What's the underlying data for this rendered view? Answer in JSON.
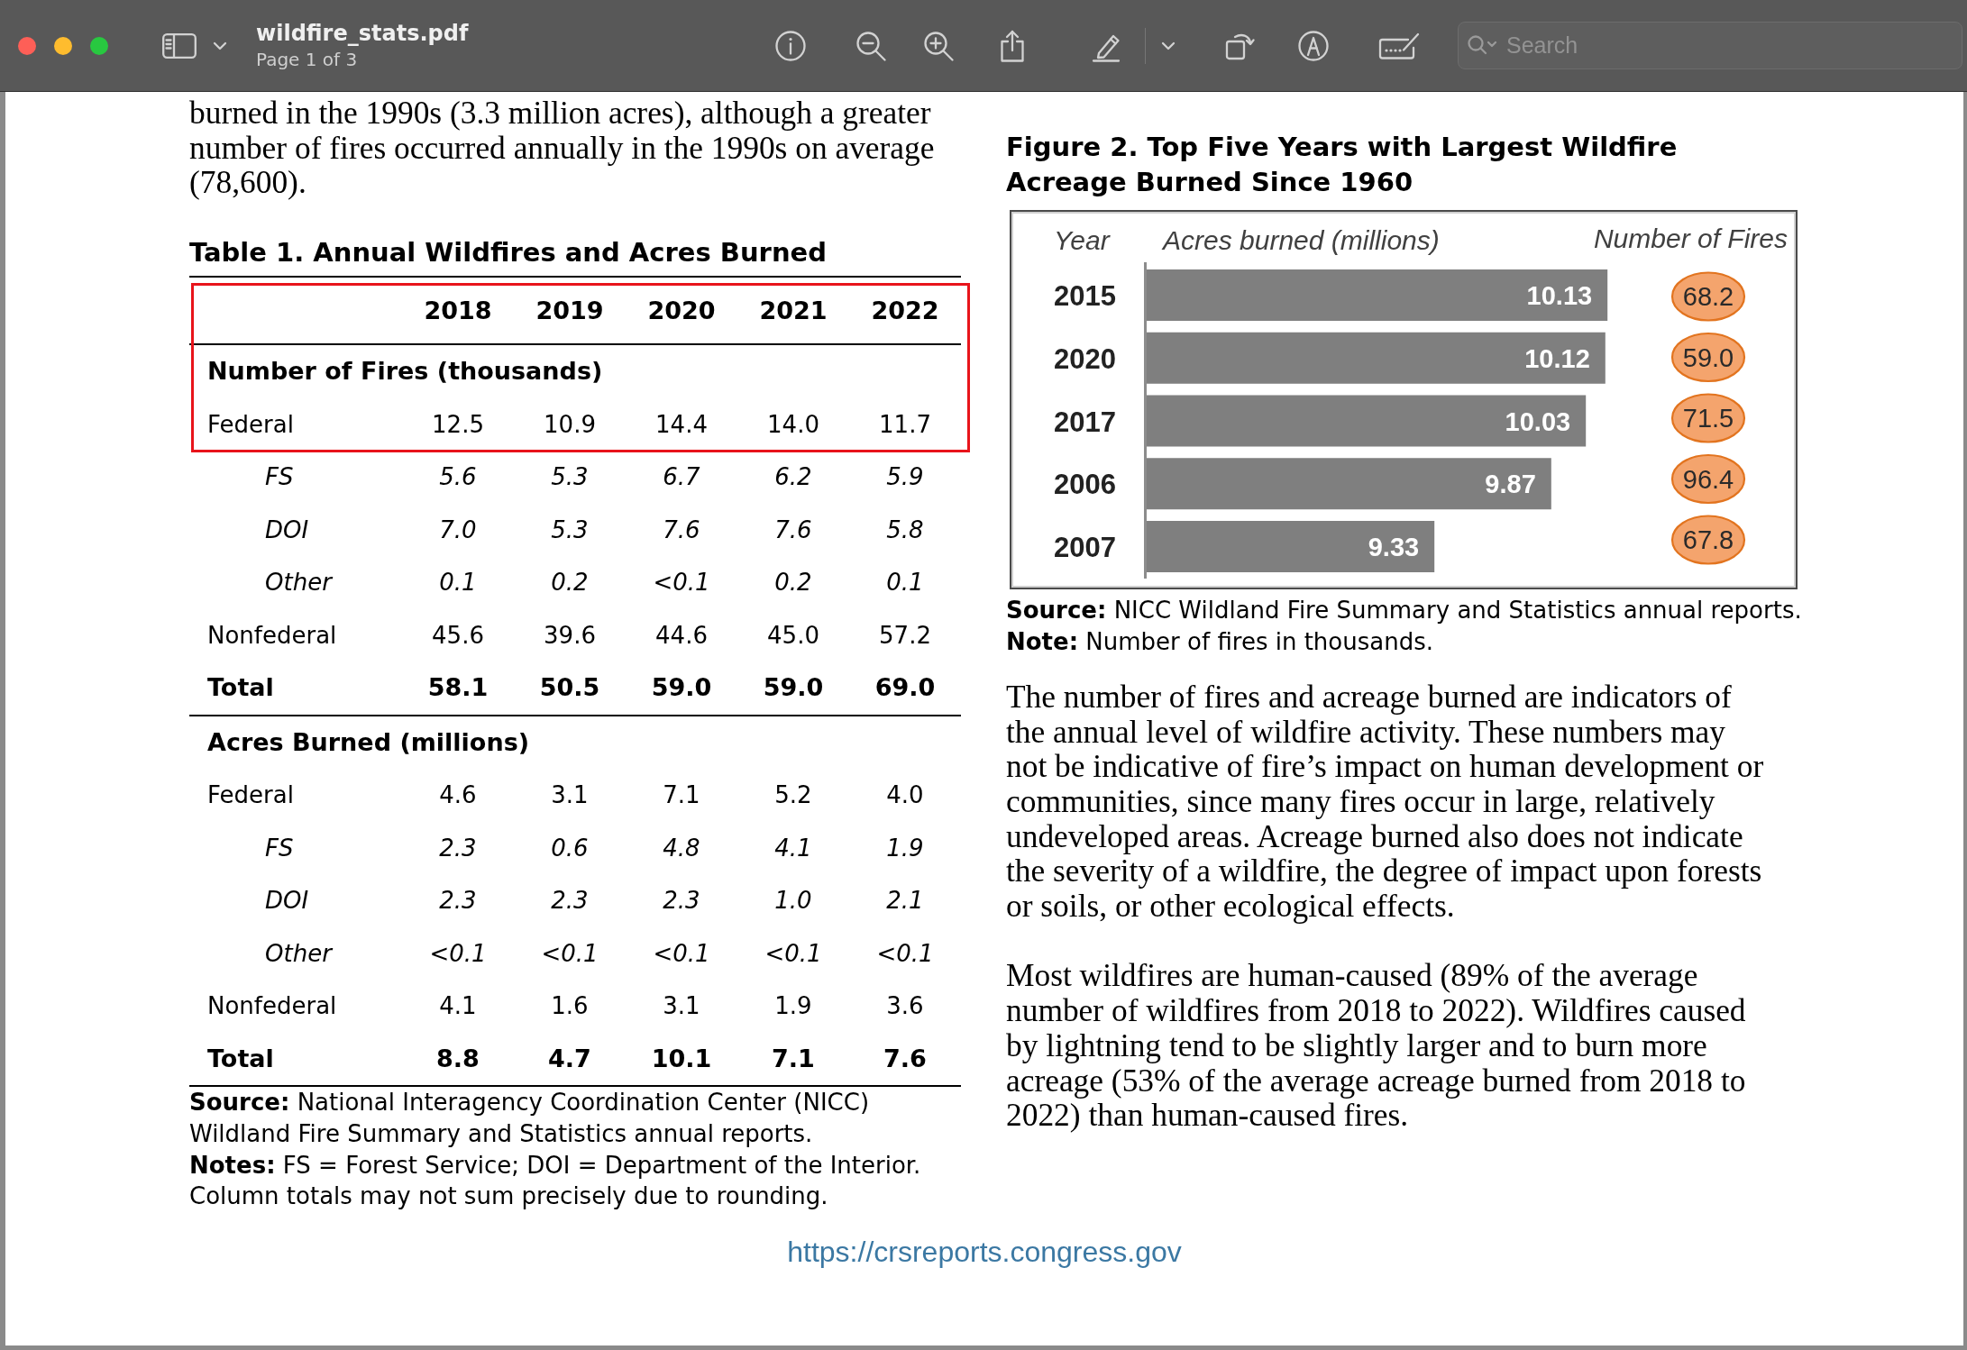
{
  "window": {
    "title": "wildfire_stats.pdf",
    "subtitle": "Page 1 of 3"
  },
  "search": {
    "placeholder": "Search"
  },
  "document": {
    "intro_paragraph": "burned in the 1990s (3.3 million acres), although a greater number of fires occurred annually in the 1990s on average (78,600).",
    "table": {
      "title": "Table 1. Annual Wildfires and Acres Burned",
      "header": {
        "columns": [
          "2018",
          "2019",
          "2020",
          "2021",
          "2022"
        ],
        "highlighted": true
      },
      "rows": [
        {
          "kind": "section",
          "label": "Number of Fires (thousands)",
          "highlighted": true
        },
        {
          "kind": "main",
          "label": "Federal",
          "values": [
            "12.5",
            "10.9",
            "14.4",
            "14.0",
            "11.7"
          ],
          "highlighted": true
        },
        {
          "kind": "sub",
          "label": "FS",
          "values": [
            "5.6",
            "5.3",
            "6.7",
            "6.2",
            "5.9"
          ],
          "highlighted": false
        },
        {
          "kind": "sub",
          "label": "DOI",
          "values": [
            "7.0",
            "5.3",
            "7.6",
            "7.6",
            "5.8"
          ],
          "highlighted": false
        },
        {
          "kind": "sub",
          "label": "Other",
          "values": [
            "0.1",
            "0.2",
            "<0.1",
            "0.2",
            "0.1"
          ],
          "highlighted": false
        },
        {
          "kind": "main",
          "label": "Nonfederal",
          "values": [
            "45.6",
            "39.6",
            "44.6",
            "45.0",
            "57.2"
          ],
          "highlighted": false
        },
        {
          "kind": "total",
          "label": "Total",
          "values": [
            "58.1",
            "50.5",
            "59.0",
            "59.0",
            "69.0"
          ],
          "highlighted": false
        },
        {
          "kind": "section",
          "label": "Acres Burned (millions)",
          "highlighted": false
        },
        {
          "kind": "main",
          "label": "Federal",
          "values": [
            "4.6",
            "3.1",
            "7.1",
            "5.2",
            "4.0"
          ],
          "highlighted": false
        },
        {
          "kind": "sub",
          "label": "FS",
          "values": [
            "2.3",
            "0.6",
            "4.8",
            "4.1",
            "1.9"
          ],
          "highlighted": false
        },
        {
          "kind": "sub",
          "label": "DOI",
          "values": [
            "2.3",
            "2.3",
            "2.3",
            "1.0",
            "2.1"
          ],
          "highlighted": false
        },
        {
          "kind": "sub",
          "label": "Other",
          "values": [
            "<0.1",
            "<0.1",
            "<0.1",
            "<0.1",
            "<0.1"
          ],
          "highlighted": false
        },
        {
          "kind": "main",
          "label": "Nonfederal",
          "values": [
            "4.1",
            "1.6",
            "3.1",
            "1.9",
            "3.6"
          ],
          "highlighted": false
        },
        {
          "kind": "total",
          "label": "Total",
          "values": [
            "8.8",
            "4.7",
            "10.1",
            "7.1",
            "7.6"
          ],
          "highlighted": false
        }
      ]
    },
    "table_notes": [
      "**Source:** National Interagency Coordination Center (NICC) Wildland Fire Summary and Statistics annual reports.",
      "**Notes:** FS = Forest Service; DOI = Department of the Interior. Column totals may not sum precisely due to rounding."
    ],
    "figure": {
      "title": "Figure 2. Top Five Years with Largest Wildfire Acreage Burned Since 1960",
      "chart_data": {
        "type": "bar",
        "orientation": "horizontal",
        "ylabel": "Year",
        "xlabel": "Acres burned (millions)",
        "categories": [
          "2015",
          "2020",
          "2017",
          "2006",
          "2007"
        ],
        "values": [
          10.13,
          10.12,
          10.03,
          9.87,
          9.33
        ],
        "xlim": [
          8,
          11
        ],
        "data_labels": true
      },
      "fires_heading": "Number of Fires",
      "fires": [
        "68.2",
        "59.0",
        "71.5",
        "96.4",
        "67.8"
      ],
      "source": "**Source:** NICC Wildland Fire Summary and Statistics annual reports.",
      "note": "**Note:** Number of fires in thousands."
    },
    "paragraphs": [
      "The number of fires and acreage burned are indicators of the annual level of wildfire activity. These numbers may not be indicative of fire’s impact on human development or communities, since many fires occur in large, relatively undeveloped areas. Acreage burned also does not indicate the severity of a wildfire, the degree of impact upon forests or soils, or other ecological effects.",
      "Most wildfires are human-caused (89% of the average number of wildfires from 2018 to 2022). Wildfires caused by lightning tend to be slightly larger and to burn more acreage (53% of the average acreage burned from 2018 to 2022) than human-caused fires."
    ],
    "footer_link": "https://crsreports.congress.gov"
  }
}
